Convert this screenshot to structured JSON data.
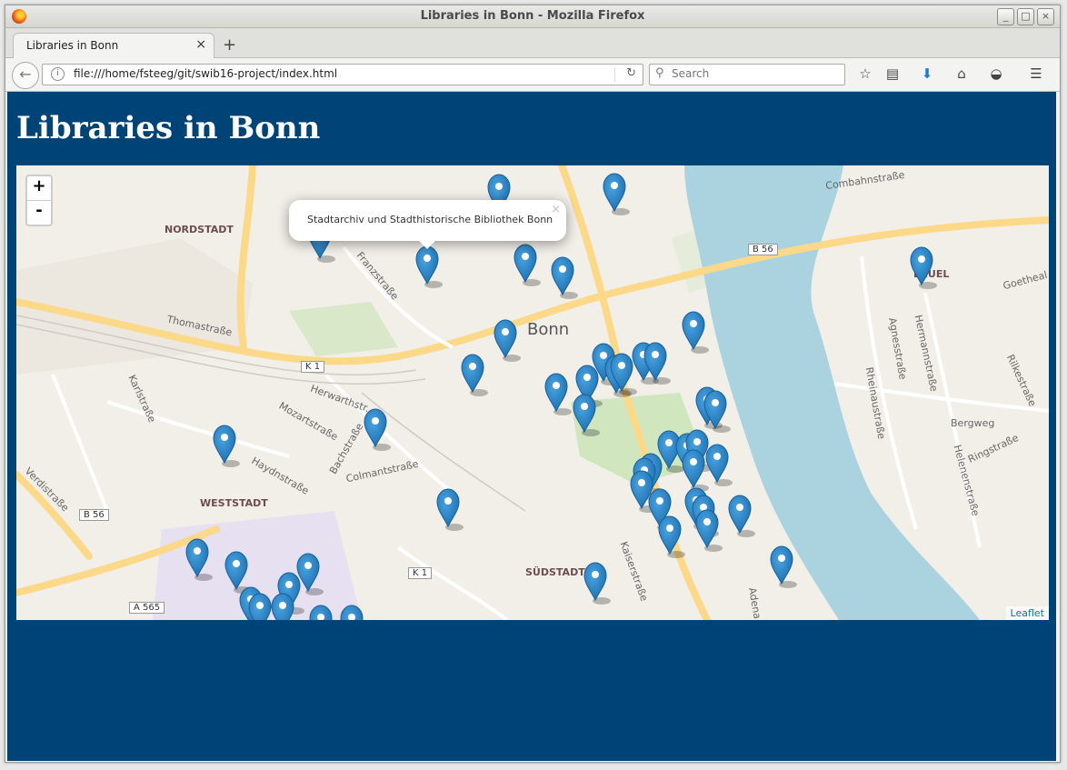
{
  "window": {
    "title": "Libraries in Bonn - Mozilla Firefox"
  },
  "tab": {
    "label": "Libraries in Bonn",
    "close": "×",
    "new_tab": "+"
  },
  "navbar": {
    "url": "file:///home/fsteeg/git/swib16-project/index.html",
    "search_placeholder": "Search"
  },
  "page": {
    "heading": "Libraries in Bonn"
  },
  "map": {
    "zoom_in": "+",
    "zoom_out": "-",
    "popup_text": "Stadtarchiv und Stadthistorische Bibliothek Bonn",
    "popup_close": "×",
    "attribution": "Leaflet",
    "labels": {
      "city": "Bonn",
      "nordstadt": "NORDSTADT",
      "weststadt": "WESTSTADT",
      "suedstadt": "SÜDSTADT",
      "beuel": "BEUEL",
      "franzstrasse": "Franzstraße",
      "thomastrasse": "Thomastraße",
      "herwarthstrasse": "Herwarthstr.",
      "mozartstrasse": "Mozartstraße",
      "karlstrasse": "Karlstraße",
      "haydnstrasse": "Haydnstraße",
      "colmantstrasse": "Colmantstraße",
      "bachstrasse": "Bachstraße",
      "verdistrasse": "Verdistraße",
      "kaiserstrasse": "Kaiserstraße",
      "adenauer": "Adena",
      "rheinaustrasse": "Rheinaustraße",
      "agnesstrasse": "Agnesstraße",
      "hermannstrasse": "Hermannstraße",
      "helenenstrasse": "Helenenstraße",
      "rilkestrasse": "Rilkestraße",
      "bergweg": "Bergweg",
      "ringstrasse": "Ringstraße",
      "combahnstrasse": "Combahnstraße",
      "goetheallee": "Goetheal",
      "b56_a": "B 56",
      "b56_b": "B 56",
      "k1_a": "K 1",
      "k1_b": "K 1",
      "a565": "A 565"
    }
  }
}
